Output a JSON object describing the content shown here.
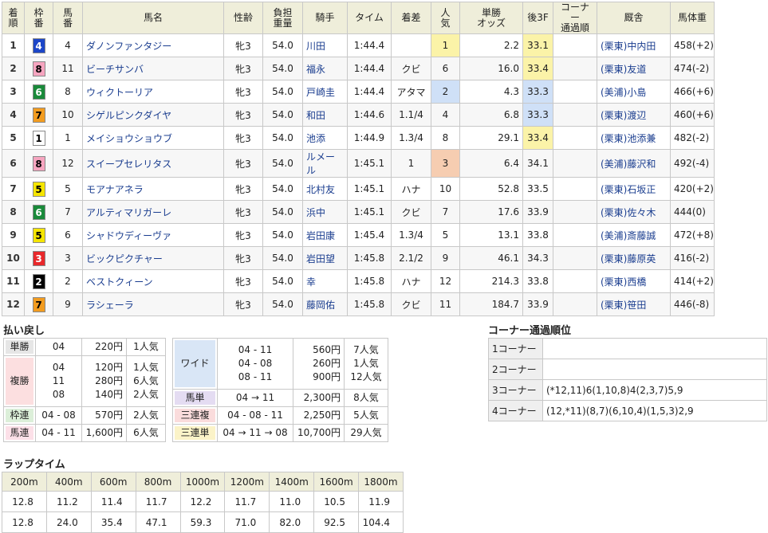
{
  "results": {
    "headers": [
      "着順",
      "枠番",
      "馬番",
      "馬名",
      "性齢",
      "負担重量",
      "騎手",
      "タイム",
      "着差",
      "人気",
      "単勝オッズ",
      "後3F",
      "コーナー通過順",
      "厩舎",
      "馬体重"
    ],
    "header_lines": [
      [
        "着",
        "順"
      ],
      [
        "枠",
        "番"
      ],
      [
        "馬",
        "番"
      ],
      [
        "馬名"
      ],
      [
        "性齢"
      ],
      [
        "負担",
        "重量"
      ],
      [
        "騎手"
      ],
      [
        "タイム"
      ],
      [
        "着差"
      ],
      [
        "人",
        "気"
      ],
      [
        "単勝",
        "オッズ"
      ],
      [
        "後3F"
      ],
      [
        "コーナー",
        "通過順"
      ],
      [
        "厩舎"
      ],
      [
        "馬体重"
      ]
    ],
    "rows": [
      {
        "pos": "1",
        "waku": "4",
        "num": "4",
        "name": "ダノンファンタジー",
        "sex": "牝3",
        "wt": "54.0",
        "jockey": "川田",
        "time": "1:44.4",
        "margin": "",
        "pop": "1",
        "odds": "2.2",
        "l3f": "33.1",
        "corner": "",
        "trainer": "(栗東)中内田",
        "body": "458(+2)"
      },
      {
        "pos": "2",
        "waku": "8",
        "num": "11",
        "name": "ビーチサンバ",
        "sex": "牝3",
        "wt": "54.0",
        "jockey": "福永",
        "time": "1:44.4",
        "margin": "クビ",
        "pop": "6",
        "odds": "16.0",
        "l3f": "33.4",
        "corner": "",
        "trainer": "(栗東)友道",
        "body": "474(-2)"
      },
      {
        "pos": "3",
        "waku": "6",
        "num": "8",
        "name": "ウィクトーリア",
        "sex": "牝3",
        "wt": "54.0",
        "jockey": "戸崎圭",
        "time": "1:44.4",
        "margin": "アタマ",
        "pop": "2",
        "odds": "4.3",
        "l3f": "33.3",
        "corner": "",
        "trainer": "(美浦)小島",
        "body": "466(+6)"
      },
      {
        "pos": "4",
        "waku": "7",
        "num": "10",
        "name": "シゲルピンクダイヤ",
        "sex": "牝3",
        "wt": "54.0",
        "jockey": "和田",
        "time": "1:44.6",
        "margin": "1.1/4",
        "pop": "4",
        "odds": "6.8",
        "l3f": "33.3",
        "corner": "",
        "trainer": "(栗東)渡辺",
        "body": "460(+6)"
      },
      {
        "pos": "5",
        "waku": "1",
        "num": "1",
        "name": "メイショウショウブ",
        "sex": "牝3",
        "wt": "54.0",
        "jockey": "池添",
        "time": "1:44.9",
        "margin": "1.3/4",
        "pop": "8",
        "odds": "29.1",
        "l3f": "33.4",
        "corner": "",
        "trainer": "(栗東)池添兼",
        "body": "482(-2)"
      },
      {
        "pos": "6",
        "waku": "8",
        "num": "12",
        "name": "スイープセレリタス",
        "sex": "牝3",
        "wt": "54.0",
        "jockey": "ルメール",
        "time": "1:45.1",
        "margin": "1",
        "pop": "3",
        "odds": "6.4",
        "l3f": "34.1",
        "corner": "",
        "trainer": "(美浦)藤沢和",
        "body": "492(-4)"
      },
      {
        "pos": "7",
        "waku": "5",
        "num": "5",
        "name": "モアナアネラ",
        "sex": "牝3",
        "wt": "54.0",
        "jockey": "北村友",
        "time": "1:45.1",
        "margin": "ハナ",
        "pop": "10",
        "odds": "52.8",
        "l3f": "33.5",
        "corner": "",
        "trainer": "(栗東)石坂正",
        "body": "420(+2)"
      },
      {
        "pos": "8",
        "waku": "6",
        "num": "7",
        "name": "アルティマリガーレ",
        "sex": "牝3",
        "wt": "54.0",
        "jockey": "浜中",
        "time": "1:45.1",
        "margin": "クビ",
        "pop": "7",
        "odds": "17.6",
        "l3f": "33.9",
        "corner": "",
        "trainer": "(栗東)佐々木",
        "body": "444(0)"
      },
      {
        "pos": "9",
        "waku": "5",
        "num": "6",
        "name": "シャドウディーヴァ",
        "sex": "牝3",
        "wt": "54.0",
        "jockey": "岩田康",
        "time": "1:45.4",
        "margin": "1.3/4",
        "pop": "5",
        "odds": "13.1",
        "l3f": "33.8",
        "corner": "",
        "trainer": "(美浦)斎藤誠",
        "body": "472(+8)"
      },
      {
        "pos": "10",
        "waku": "3",
        "num": "3",
        "name": "ビックピクチャー",
        "sex": "牝3",
        "wt": "54.0",
        "jockey": "岩田望",
        "time": "1:45.8",
        "margin": "2.1/2",
        "pop": "9",
        "odds": "46.1",
        "l3f": "34.3",
        "corner": "",
        "trainer": "(栗東)藤原英",
        "body": "416(-2)"
      },
      {
        "pos": "11",
        "waku": "2",
        "num": "2",
        "name": "ベストクィーン",
        "sex": "牝3",
        "wt": "54.0",
        "jockey": "幸",
        "time": "1:45.8",
        "margin": "ハナ",
        "pop": "12",
        "odds": "214.3",
        "l3f": "33.8",
        "corner": "",
        "trainer": "(栗東)西橋",
        "body": "414(+2)"
      },
      {
        "pos": "12",
        "waku": "7",
        "num": "9",
        "name": "ラシェーラ",
        "sex": "牝3",
        "wt": "54.0",
        "jockey": "藤岡佑",
        "time": "1:45.8",
        "margin": "クビ",
        "pop": "11",
        "odds": "184.7",
        "l3f": "33.9",
        "corner": "",
        "trainer": "(栗東)笹田",
        "body": "446(-8)"
      }
    ]
  },
  "payout": {
    "title": "払い戻し",
    "left": [
      {
        "label": "単勝",
        "cls": "lab-tan",
        "nums": [
          "04"
        ],
        "yen": [
          "220円"
        ],
        "pop": [
          "1人気"
        ]
      },
      {
        "label": "複勝",
        "cls": "lab-fuku",
        "nums": [
          "04",
          "11",
          "08"
        ],
        "yen": [
          "120円",
          "280円",
          "140円"
        ],
        "pop": [
          "1人気",
          "6人気",
          "2人気"
        ]
      },
      {
        "label": "枠連",
        "cls": "lab-wak",
        "nums": [
          "04 - 08"
        ],
        "yen": [
          "570円"
        ],
        "pop": [
          "2人気"
        ]
      },
      {
        "label": "馬連",
        "cls": "lab-uma",
        "nums": [
          "04 - 11"
        ],
        "yen": [
          "1,600円"
        ],
        "pop": [
          "6人気"
        ]
      }
    ],
    "right": [
      {
        "label": "ワイド",
        "cls": "lab-wide",
        "nums": [
          "04 - 11",
          "04 - 08",
          "08 - 11"
        ],
        "yen": [
          "560円",
          "260円",
          "900円"
        ],
        "pop": [
          "7人気",
          "1人気",
          "12人気"
        ]
      },
      {
        "label": "馬単",
        "cls": "lab-umt",
        "nums": [
          "04 → 11"
        ],
        "yen": [
          "2,300円"
        ],
        "pop": [
          "8人気"
        ]
      },
      {
        "label": "三連複",
        "cls": "lab-san",
        "nums": [
          "04 - 08 - 11"
        ],
        "yen": [
          "2,250円"
        ],
        "pop": [
          "5人気"
        ]
      },
      {
        "label": "三連単",
        "cls": "lab-tan3",
        "nums": [
          "04 → 11 → 08"
        ],
        "yen": [
          "10,700円"
        ],
        "pop": [
          "29人気"
        ]
      }
    ]
  },
  "corner": {
    "title": "コーナー通過順位",
    "rows": [
      {
        "label": "1コーナー",
        "value": ""
      },
      {
        "label": "2コーナー",
        "value": ""
      },
      {
        "label": "3コーナー",
        "value": "(*12,11)6(1,10,8)4(2,3,7)5,9"
      },
      {
        "label": "4コーナー",
        "value": "(12,*11)(8,7)(6,10,4)(1,5,3)2,9"
      }
    ]
  },
  "lap": {
    "title": "ラップタイム",
    "headers": [
      "200m",
      "400m",
      "600m",
      "800m",
      "1000m",
      "1200m",
      "1400m",
      "1600m",
      "1800m"
    ],
    "laps": [
      "12.8",
      "11.2",
      "11.4",
      "11.7",
      "12.2",
      "11.7",
      "11.0",
      "10.5",
      "11.9"
    ],
    "cumulative": [
      "12.8",
      "24.0",
      "35.4",
      "47.1",
      "59.3",
      "71.0",
      "82.0",
      "92.5",
      "104.4"
    ]
  },
  "colors": {
    "header_bg": "#efeeda",
    "link": "#1a3d8f"
  }
}
